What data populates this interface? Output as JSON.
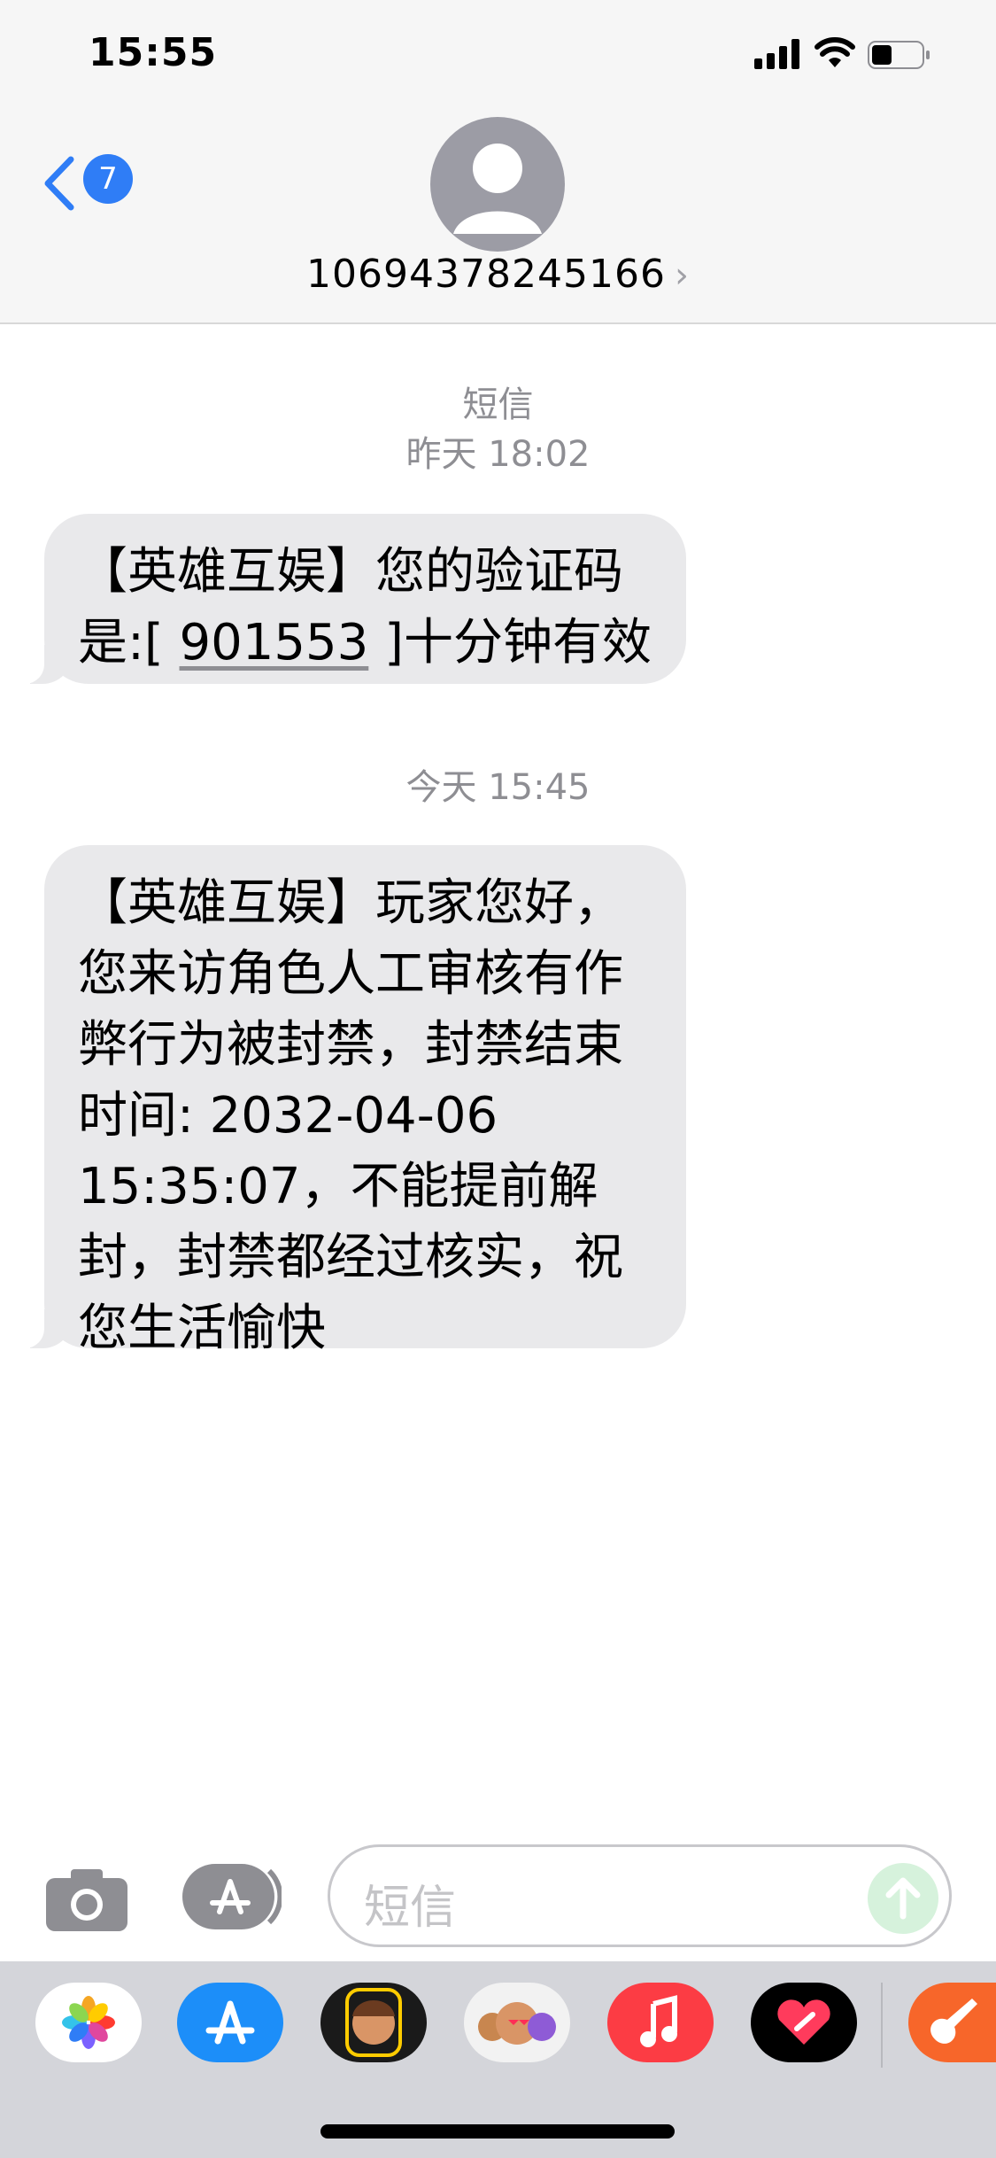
{
  "status_bar": {
    "time": "15:55"
  },
  "header": {
    "back_badge": "7",
    "contact": "10694378245166"
  },
  "thread": {
    "stamp1_label": "短信",
    "stamp1_time": "昨天 18:02",
    "message1_prefix": "【英雄互娱】您的验证码是:[ ",
    "message1_code": "901553",
    "message1_suffix": " ]十分钟有效",
    "stamp2": "今天 15:45",
    "message2": "【英雄互娱】玩家您好，您来访角色人工审核有作弊行为被封禁，封禁结束时间: 2032-04-06 15:35:07，不能提前解封，封禁都经过核实，祝您生活愉快"
  },
  "input_bar": {
    "placeholder": "短信"
  },
  "app_drawer": {
    "apps": [
      "photos-icon",
      "app-store-icon",
      "memoji-icon",
      "animoji-icon",
      "music-icon",
      "digital-touch-icon",
      "garageband-icon"
    ]
  },
  "colors": {
    "accent": "#2f7df6",
    "bubble": "#e9e9eb",
    "header_bg": "#f6f6f6",
    "drawer_bg": "#d4d5da"
  }
}
